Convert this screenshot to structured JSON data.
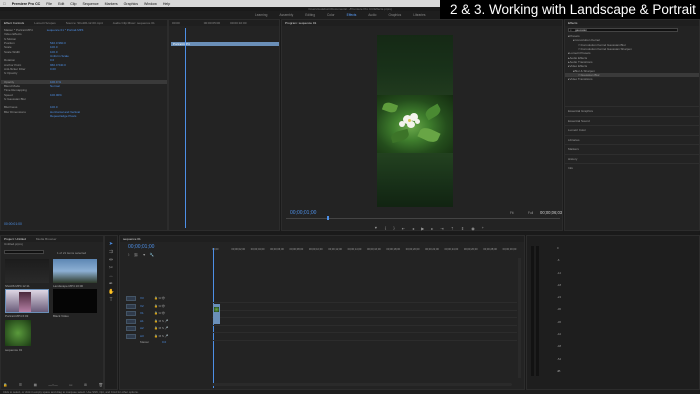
{
  "menubar": {
    "app": "Premiere Pro CC",
    "items": [
      "File",
      "Edit",
      "Clip",
      "Sequence",
      "Markers",
      "Graphics",
      "Window",
      "Help"
    ],
    "right": "..."
  },
  "path_title": "/Users/codeburn/Documents/.../Premiere Pro CC/Effects.prproj",
  "workspaces": [
    "Learning",
    "Assembly",
    "Editing",
    "Color",
    "Effects",
    "Audio",
    "Graphics",
    "Libraries"
  ],
  "active_workspace": "Effects",
  "banner": "2 & 3. Working with Landscape & Portrait sizes",
  "effect_controls": {
    "tabs": [
      "Effect Controls",
      "Lumetri Scopes",
      "Source: Shot06-12.00.mp4",
      "Audio Clip Mixer: sequence 01"
    ],
    "header": "Master * Portrait.MP4",
    "clip": "sequence 01 * Portrait.MP4",
    "section": "Video Effects",
    "rows": [
      {
        "label": "fx  Motion",
        "value": ""
      },
      {
        "label": "Position",
        "value": "540.0   960.0"
      },
      {
        "label": "Scale",
        "value": "100.0"
      },
      {
        "label": "Scale Width",
        "value": "100.0"
      },
      {
        "label": "",
        "value": "Uniform Scale"
      },
      {
        "label": "Rotation",
        "value": "0.0"
      },
      {
        "label": "Anchor Point",
        "value": "960.0   540.0"
      },
      {
        "label": "Anti-flicker Filter",
        "value": "0.00"
      },
      {
        "label": "fx  Opacity",
        "value": ""
      },
      {
        "label": "",
        "value": ""
      },
      {
        "label": "Opacity",
        "value": "100.0 %"
      },
      {
        "label": "Blend Mode",
        "value": "Normal"
      },
      {
        "label": "Time Remapping",
        "value": ""
      },
      {
        "label": "Speed",
        "value": "100.00%"
      },
      {
        "label": "fx  Gaussian Blur",
        "value": ""
      },
      {
        "label": "",
        "value": ""
      },
      {
        "label": "Blurriness",
        "value": "100.0"
      },
      {
        "label": "Blur Dimensions",
        "value": "Horizontal and Vertical"
      },
      {
        "label": "",
        "value": "Repeat Edge Pixels"
      }
    ],
    "timecode": "00:00:01:00"
  },
  "ec_timeline": {
    "start": "00:00",
    "mid": "00:00:05:00",
    "end": "00:00:10:00",
    "clip_label": "Portrait.MP4"
  },
  "program": {
    "tab": "Program: sequence 01",
    "timecode": "00;00;01;00",
    "fit": "Fit",
    "duration": "00;00;06;03",
    "quality": "Full"
  },
  "effects_panel": {
    "tab": "Effects",
    "search_value": "gaussian",
    "tree": [
      {
        "label": "Presets",
        "indent": 0
      },
      {
        "label": "Convolution Kernel",
        "indent": 1
      },
      {
        "label": "Convolution Kernel Gaussian Blur",
        "indent": 2
      },
      {
        "label": "Convolution Kernel Gaussian Sharpen",
        "indent": 2
      },
      {
        "label": "Lumetri Presets",
        "indent": 0
      },
      {
        "label": "Audio Effects",
        "indent": 0
      },
      {
        "label": "Audio Transitions",
        "indent": 0
      },
      {
        "label": "Video Effects",
        "indent": 0
      },
      {
        "label": "Blur & Sharpen",
        "indent": 1
      },
      {
        "label": "Gaussian Blur",
        "indent": 2,
        "selected": true
      },
      {
        "label": "Video Transitions",
        "indent": 0
      }
    ],
    "sections": [
      "Essential Graphics",
      "Essential Sound",
      "Lumetri Color",
      "Libraries",
      "Markers",
      "History",
      "Info"
    ]
  },
  "project": {
    "tabs": [
      "Project: Untitled",
      "Media Browser"
    ],
    "file": "Untitled.prproj",
    "count": "1 of 21 items selected",
    "items": [
      {
        "name": "Shot06.MP4",
        "duration": "12:11"
      },
      {
        "name": "Landscape.MP4",
        "duration": "10:00"
      },
      {
        "name": "Portrait.MP4",
        "duration": "6:03"
      },
      {
        "name": "LS-TreeFlower.MP4",
        "duration": "6:06"
      },
      {
        "name": "White Flower",
        "duration": "6:03"
      },
      {
        "name": "Black Video",
        "duration": "5:00"
      },
      {
        "name": "sequence 01",
        "duration": "6:03"
      }
    ]
  },
  "timeline": {
    "tab": "sequence 01",
    "timecode": "00;00;01;00",
    "ruler": [
      "00;00",
      "00;00;02;00",
      "00;00;04;00",
      "00;00;06;00",
      "00;00;08;00",
      "00;00;10;00",
      "00;00;12;00",
      "00;00;14;00",
      "00;00;16;00",
      "00;00;18;00",
      "00;00;20;00",
      "00;00;22;00",
      "00;00;24;00",
      "00;00;26;00",
      "00;00;28;00",
      "00;00;30;00"
    ],
    "video_tracks": [
      "V3",
      "V2",
      "V1"
    ],
    "audio_tracks": [
      "A1",
      "A2",
      "A3"
    ],
    "master": "Master",
    "master_value": "0.0"
  },
  "meters": {
    "scale": [
      "0",
      "-6",
      "-12",
      "-18",
      "-24",
      "-30",
      "-36",
      "-42",
      "-48",
      "-54",
      "dB"
    ]
  },
  "status": "Click to select, or click in empty space and drag to marquee select. Use Shift, Opt, and Cmd for other options.",
  "colors": {
    "accent": "#4d8fe6",
    "panel": "#232323",
    "bg": "#1a1a1a",
    "clip": "#6a8fb8"
  }
}
